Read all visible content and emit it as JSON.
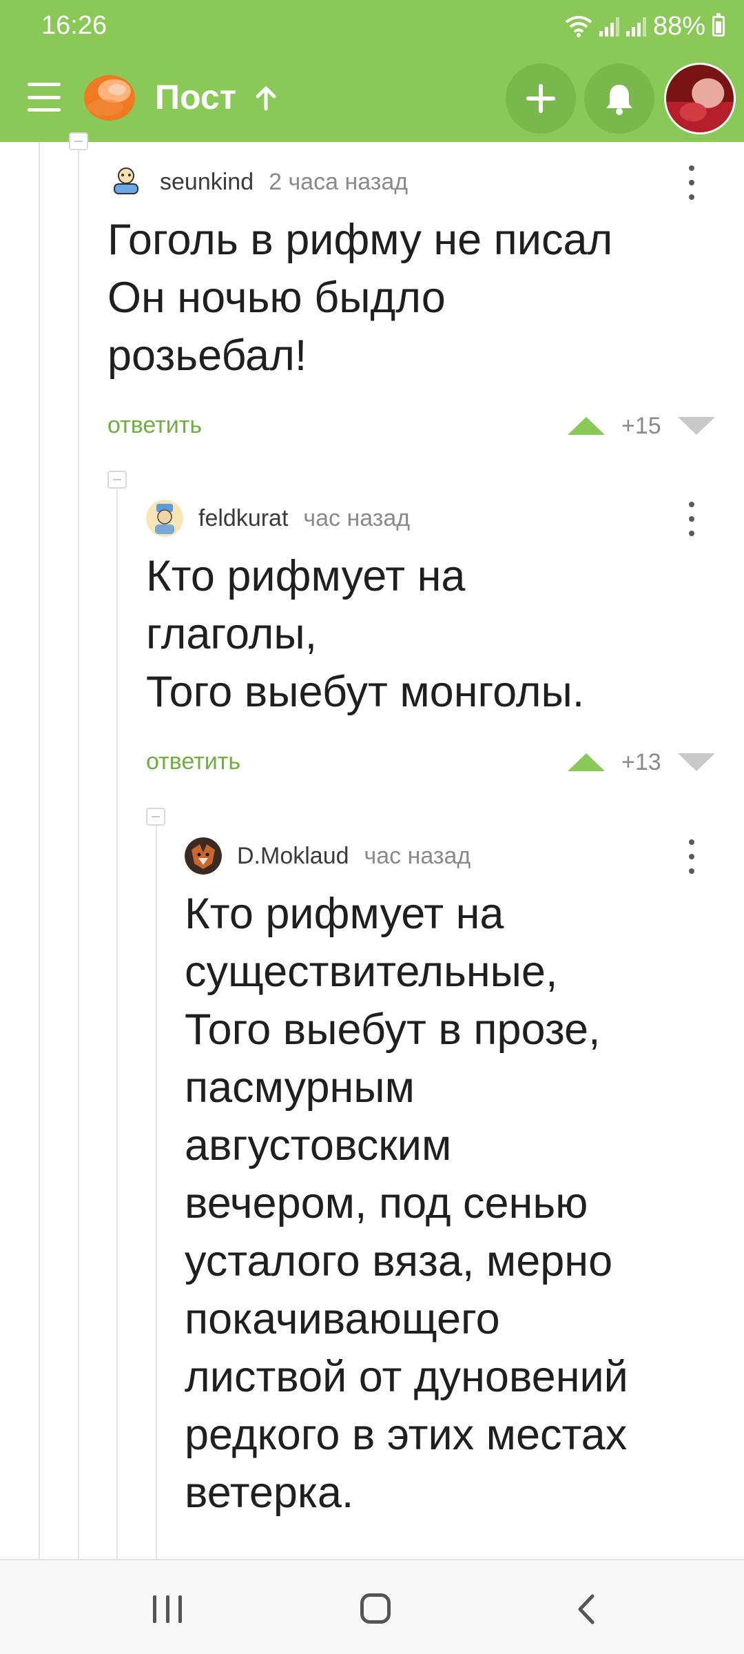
{
  "status_bar": {
    "time": "16:26",
    "battery": "88%",
    "icons": [
      "wifi-icon",
      "signal-icon",
      "signal-icon",
      "battery-icon"
    ]
  },
  "header": {
    "title": "Пост",
    "icons": [
      "menu-icon",
      "logo-icon",
      "sort-up-arrow-icon",
      "plus-icon",
      "bell-icon",
      "user-avatar"
    ]
  },
  "comments": [
    {
      "user": "seunkind",
      "time": "2 часа назад",
      "text": "Гоголь в рифму не писал\nОн ночью быдло\nрозьебал!",
      "reply": "ответить",
      "votes": "+15"
    },
    {
      "user": "feldkurat",
      "time": "час назад",
      "text": "Кто рифмует на\nглаголы,\nТого выебут монголы.",
      "reply": "ответить",
      "votes": "+13"
    },
    {
      "user": "D.Moklaud",
      "time": "час назад",
      "text": "Кто рифмует на\nсуществительные,\nТого выебут в прозе,\nпасмурным\nавгустовским\nвечером, под сенью\nусталого вяза, мерно\nпокачивающего\nлиствой от дуновений\nредкого в этих местах\nветерка.",
      "reply": "",
      "votes": ""
    }
  ],
  "colors": {
    "brand_green": "#8ac858",
    "reply_green": "#6fae3f",
    "downvote_grey": "#c9c9c9"
  },
  "nav_bar": {
    "icons": [
      "recent-apps-icon",
      "home-icon",
      "back-icon"
    ]
  }
}
